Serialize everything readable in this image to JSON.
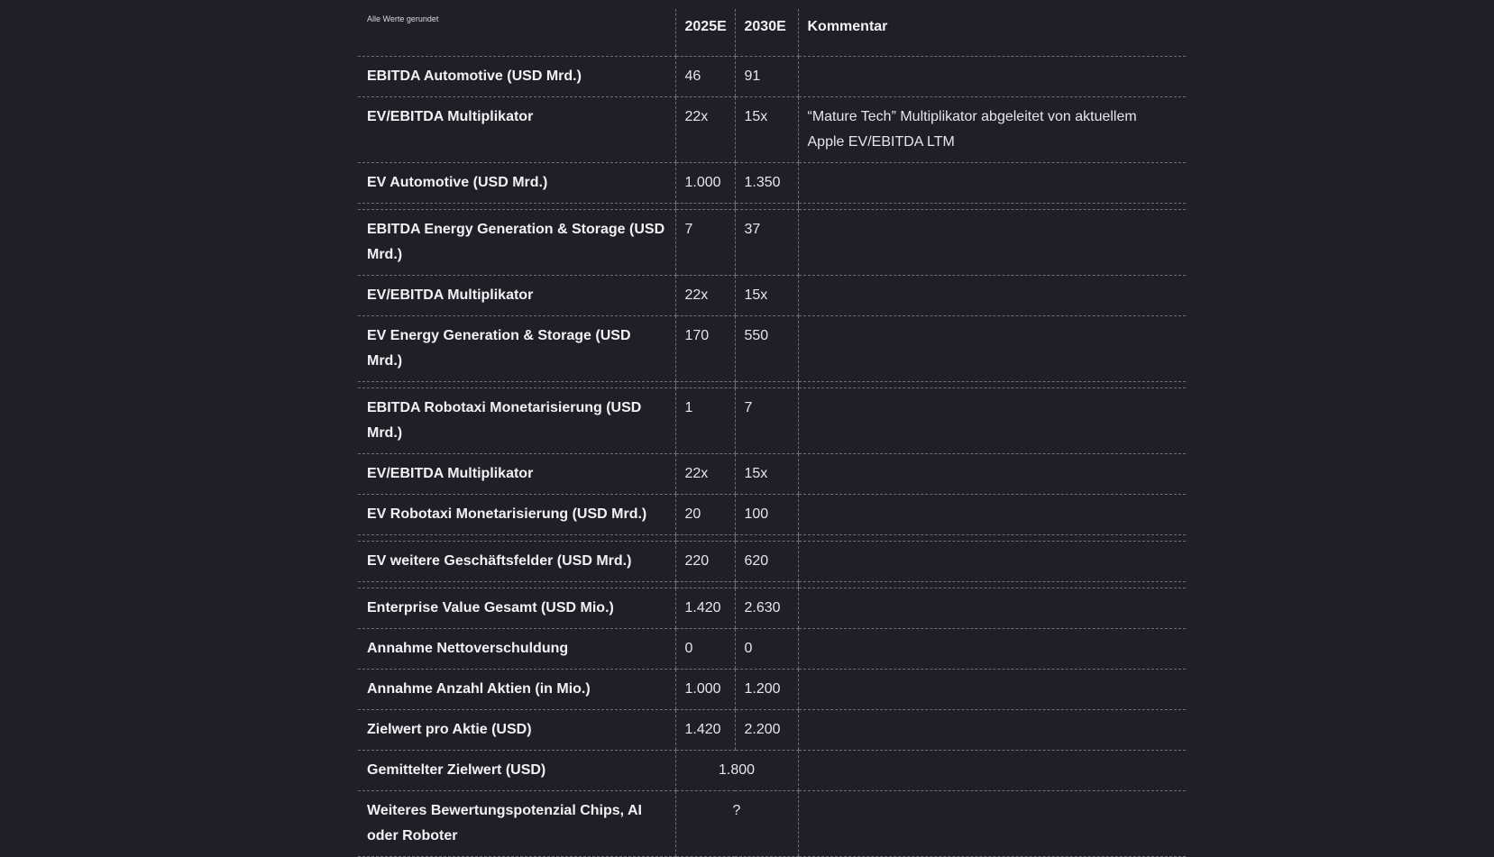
{
  "table": {
    "header": {
      "note": "Alle Werte gerundet",
      "col_2025": "2025E",
      "col_2030": "2030E",
      "col_comment": "Kommentar"
    },
    "rows": [
      {
        "label": "EBITDA Automotive (USD Mrd.)",
        "v2025": "46",
        "v2030": "91",
        "comment": ""
      },
      {
        "label": "EV/EBITDA Multiplikator",
        "v2025": "22x",
        "v2030": "15x",
        "comment": "“Mature Tech” Multiplikator abgeleitet von aktuellem Apple EV/EBITDA LTM"
      },
      {
        "label": "EV Automotive (USD Mrd.)",
        "v2025": "1.000",
        "v2030": "1.350",
        "comment": ""
      },
      {
        "label": "EBITDA Energy Generation & Storage (USD Mrd.)",
        "v2025": "7",
        "v2030": "37",
        "comment": ""
      },
      {
        "label": "EV/EBITDA Multiplikator",
        "v2025": "22x",
        "v2030": "15x",
        "comment": ""
      },
      {
        "label": "EV Energy Generation & Storage (USD Mrd.)",
        "v2025": "170",
        "v2030": "550",
        "comment": ""
      },
      {
        "label": "EBITDA Robotaxi Monetarisierung (USD Mrd.)",
        "v2025": "1",
        "v2030": "7",
        "comment": ""
      },
      {
        "label": "EV/EBITDA Multiplikator",
        "v2025": "22x",
        "v2030": "15x",
        "comment": ""
      },
      {
        "label": "EV Robotaxi Monetarisierung (USD Mrd.)",
        "v2025": "20",
        "v2030": "100",
        "comment": ""
      },
      {
        "label": "EV weitere Geschäftsfelder (USD Mrd.)",
        "v2025": "220",
        "v2030": "620",
        "comment": ""
      },
      {
        "label": "Enterprise Value Gesamt (USD Mio.)",
        "v2025": "1.420",
        "v2030": "2.630",
        "comment": ""
      },
      {
        "label": "Annahme Nettoverschuldung",
        "v2025": "0",
        "v2030": "0",
        "comment": ""
      },
      {
        "label": "Annahme Anzahl Aktien (in Mio.)",
        "v2025": "1.000",
        "v2030": "1.200",
        "comment": ""
      },
      {
        "label": "Zielwert pro Aktie (USD)",
        "v2025": "1.420",
        "v2030": "2.200",
        "comment": ""
      },
      {
        "label": "Gemittelter Zielwert (USD)",
        "merged": "1.800",
        "comment": ""
      },
      {
        "label": "Weiteres Bewertungspotenzial Chips, AI oder Roboter",
        "merged": "?",
        "comment": ""
      }
    ]
  }
}
